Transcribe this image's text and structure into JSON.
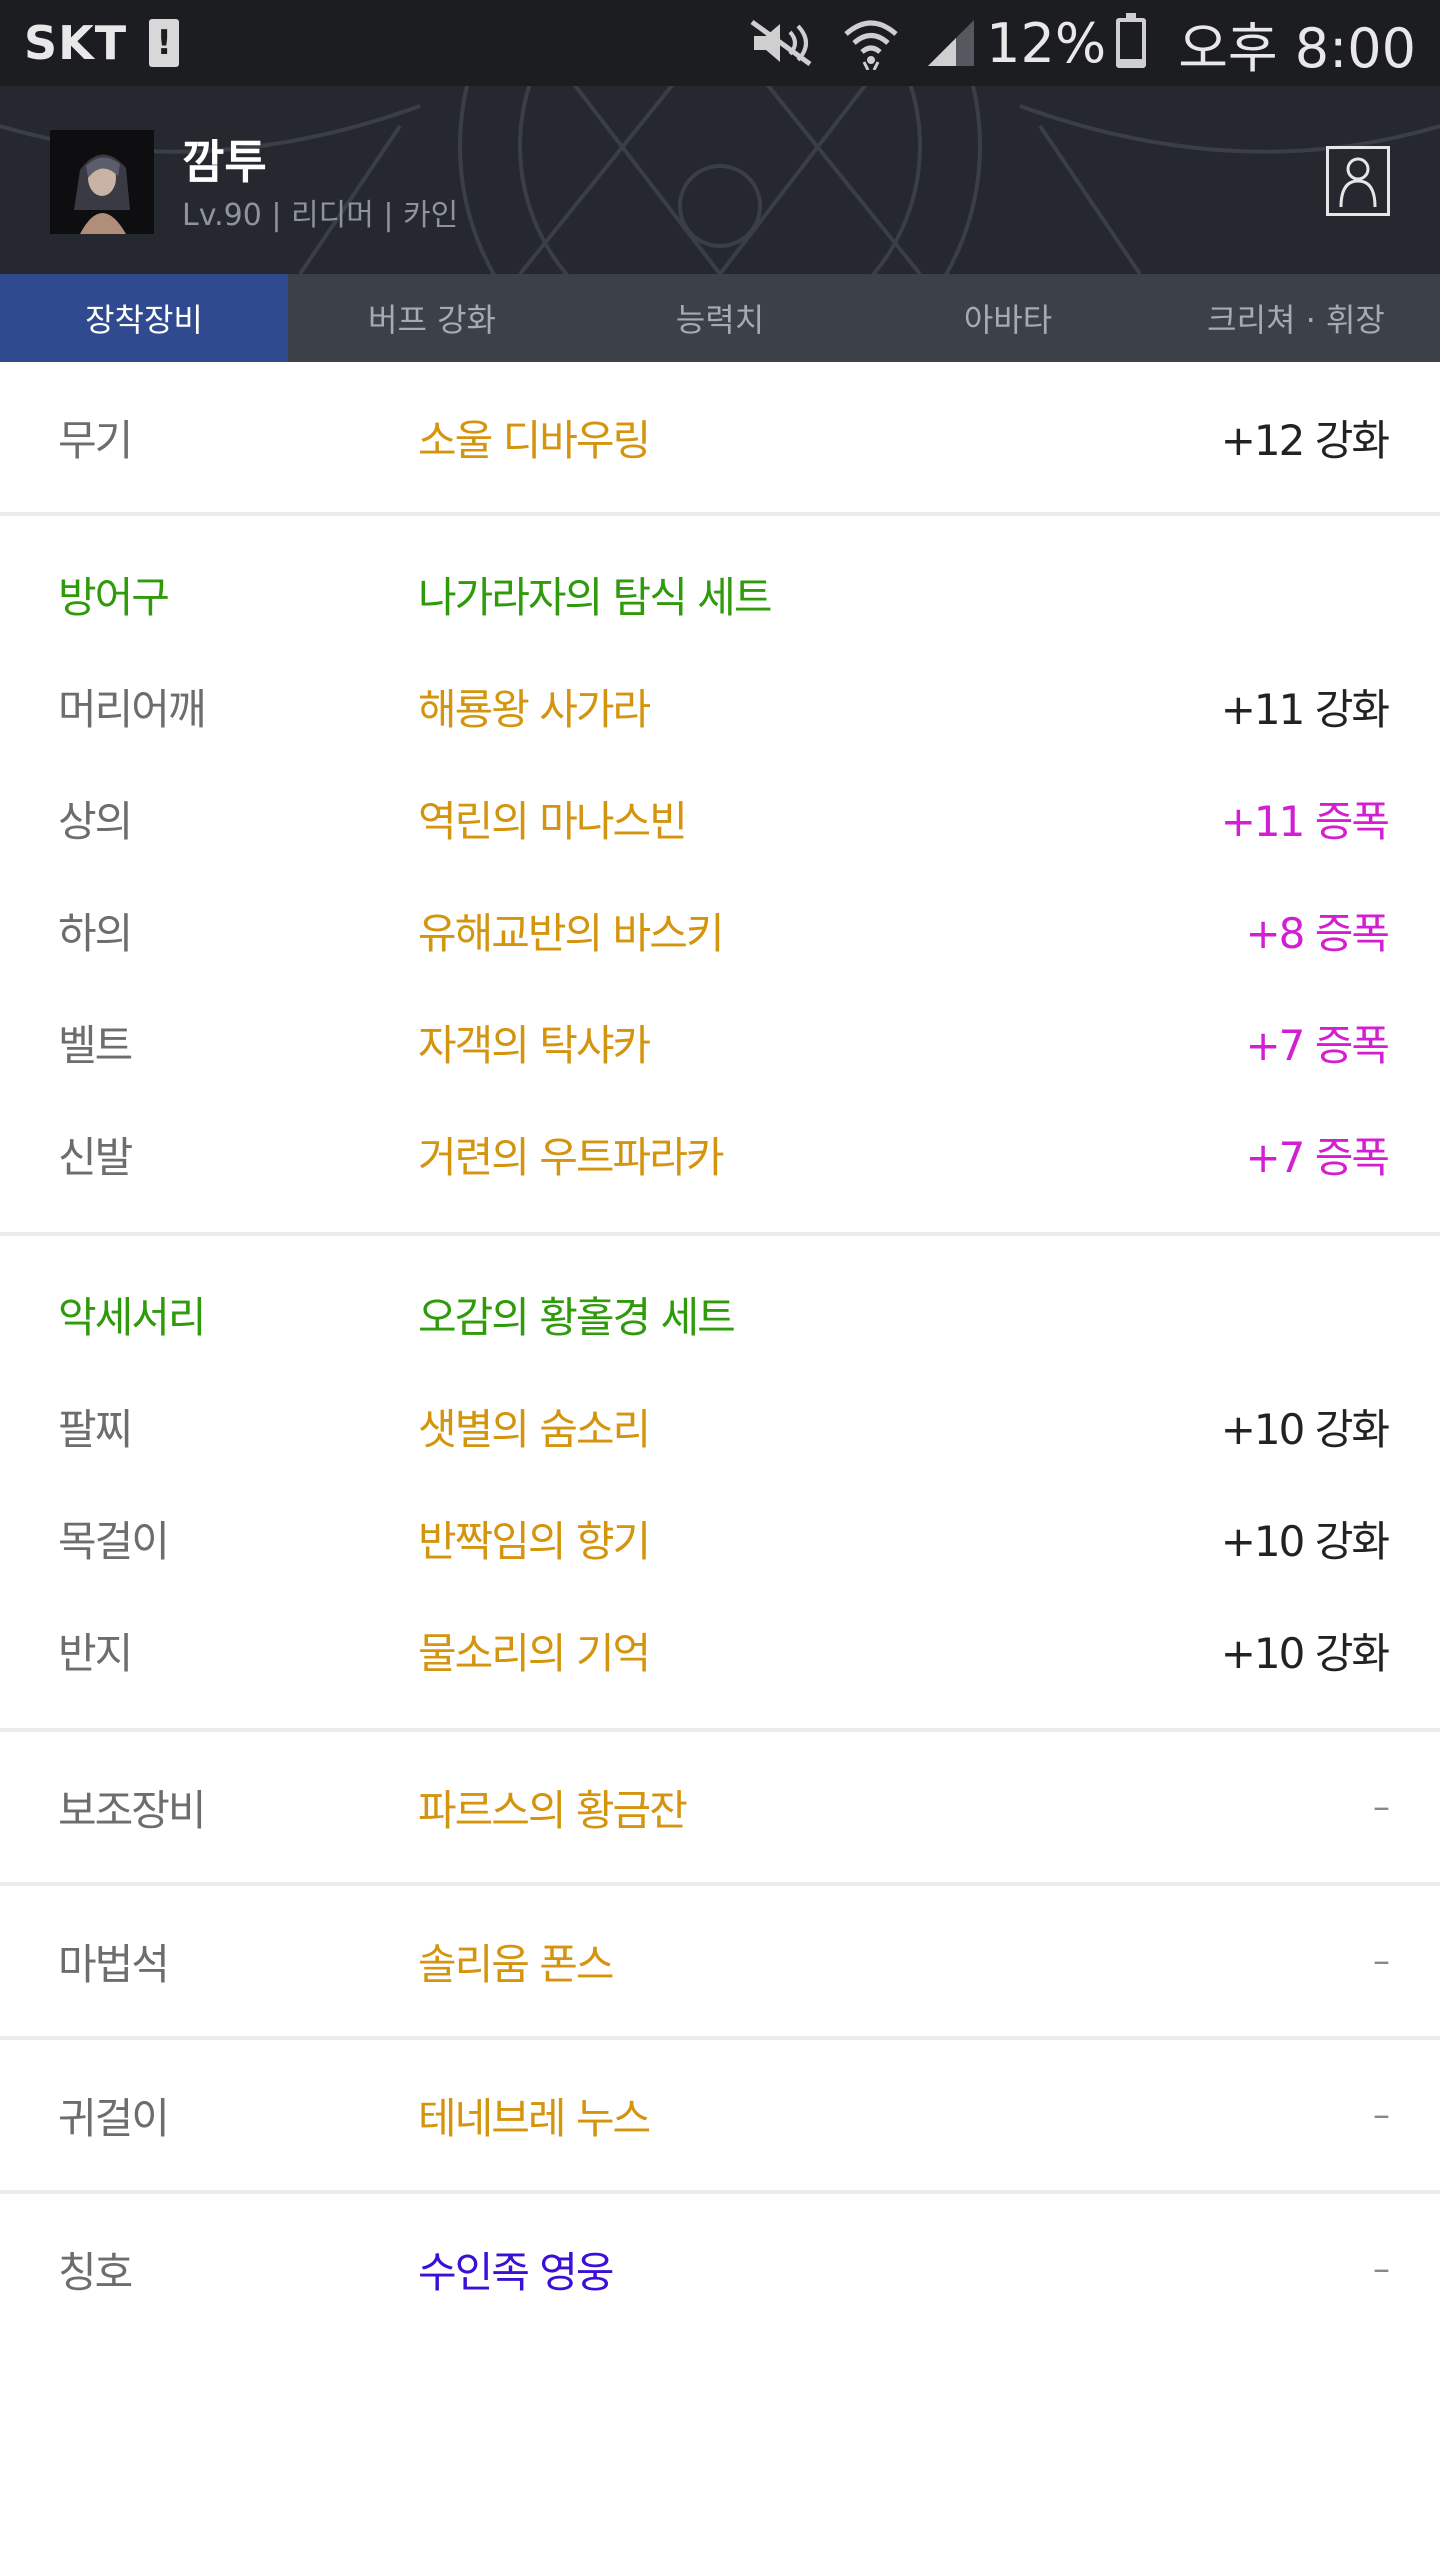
{
  "status_bar": {
    "carrier": "SKT",
    "battery_percent": "12%",
    "battery_level": 0.12,
    "time": "오후 8:00",
    "icons": [
      "alert-icon",
      "mute-icon",
      "wifi-icon",
      "signal-icon",
      "battery-icon"
    ]
  },
  "profile": {
    "name": "깜투",
    "subtitle": "Lv.90 | 리디머 | 카인"
  },
  "tabs": [
    {
      "label": "장착장비",
      "active": true
    },
    {
      "label": "버프 강화",
      "active": false
    },
    {
      "label": "능력치",
      "active": false
    },
    {
      "label": "아바타",
      "active": false
    },
    {
      "label": "크리쳐 · 휘장",
      "active": false
    }
  ],
  "equipment": {
    "weapon": {
      "slot": "무기",
      "name": "소울 디바우링",
      "value": "+12 강화"
    },
    "armor_set": {
      "slot": "방어구",
      "name": "나가라자의 탐식 세트"
    },
    "armor": [
      {
        "slot": "머리어깨",
        "name": "해룡왕 사가라",
        "value": "+11 강화"
      },
      {
        "slot": "상의",
        "name": "역린의 마나스빈",
        "value": "+11 증폭"
      },
      {
        "slot": "하의",
        "name": "유해교반의 바스키",
        "value": "+8 증폭"
      },
      {
        "slot": "벨트",
        "name": "자객의 탁샤카",
        "value": "+7 증폭"
      },
      {
        "slot": "신발",
        "name": "거련의 우트파라카",
        "value": "+7 증폭"
      }
    ],
    "accessory_set": {
      "slot": "악세서리",
      "name": "오감의 황홀경 세트"
    },
    "accessories": [
      {
        "slot": "팔찌",
        "name": "샛별의 숨소리",
        "value": "+10 강화"
      },
      {
        "slot": "목걸이",
        "name": "반짝임의 향기",
        "value": "+10 강화"
      },
      {
        "slot": "반지",
        "name": "물소리의 기억",
        "value": "+10 강화"
      }
    ],
    "sub_equipment": {
      "slot": "보조장비",
      "name": "파르스의 황금잔",
      "value": "–"
    },
    "magic_stone": {
      "slot": "마법석",
      "name": "솔리움 폰스",
      "value": "–"
    },
    "earring": {
      "slot": "귀걸이",
      "name": "테네브레 누스",
      "value": "–"
    },
    "title": {
      "slot": "칭호",
      "name": "수인족 영웅",
      "value": "–"
    }
  },
  "colors": {
    "item_name": "#d4940d",
    "set_name": "#2f9a0a",
    "amplify": "#d21fd3",
    "title_item": "#3b0fd6",
    "active_tab": "#2f4a8f"
  }
}
